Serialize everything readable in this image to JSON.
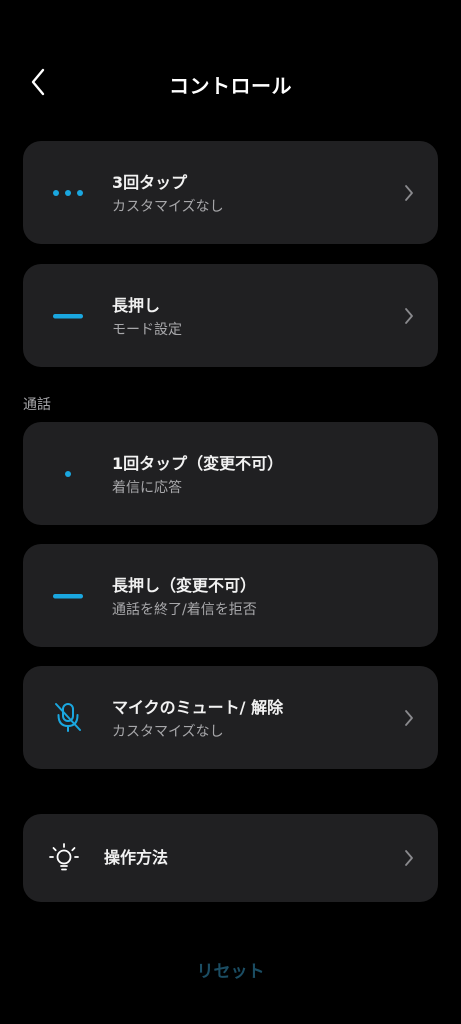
{
  "header": {
    "title": "コントロール"
  },
  "colors": {
    "background": "#000000",
    "card": "#202022",
    "accent": "#1aa7e0",
    "subtext": "#a7a7aa",
    "reset_disabled": "#1b4d63"
  },
  "controls": {
    "triple_tap": {
      "icon": "three-dots-icon",
      "title": "3回タップ",
      "subtitle": "カスタマイズなし"
    },
    "long_press": {
      "icon": "dash-icon",
      "title": "長押し",
      "subtitle": "モード設定"
    }
  },
  "call_section": {
    "label": "通話",
    "items": [
      {
        "icon": "single-dot-icon",
        "title": "1回タップ（変更不可）",
        "subtitle": "着信に応答"
      },
      {
        "icon": "dash-icon",
        "title": "長押し（変更不可）",
        "subtitle": "通話を終了/着信を拒否"
      },
      {
        "icon": "mic-off-icon",
        "title": "マイクのミュート/ 解除",
        "subtitle": "カスタマイズなし"
      }
    ]
  },
  "how_to": {
    "icon": "lightbulb-icon",
    "title": "操作方法"
  },
  "footer": {
    "reset_label": "リセット"
  }
}
